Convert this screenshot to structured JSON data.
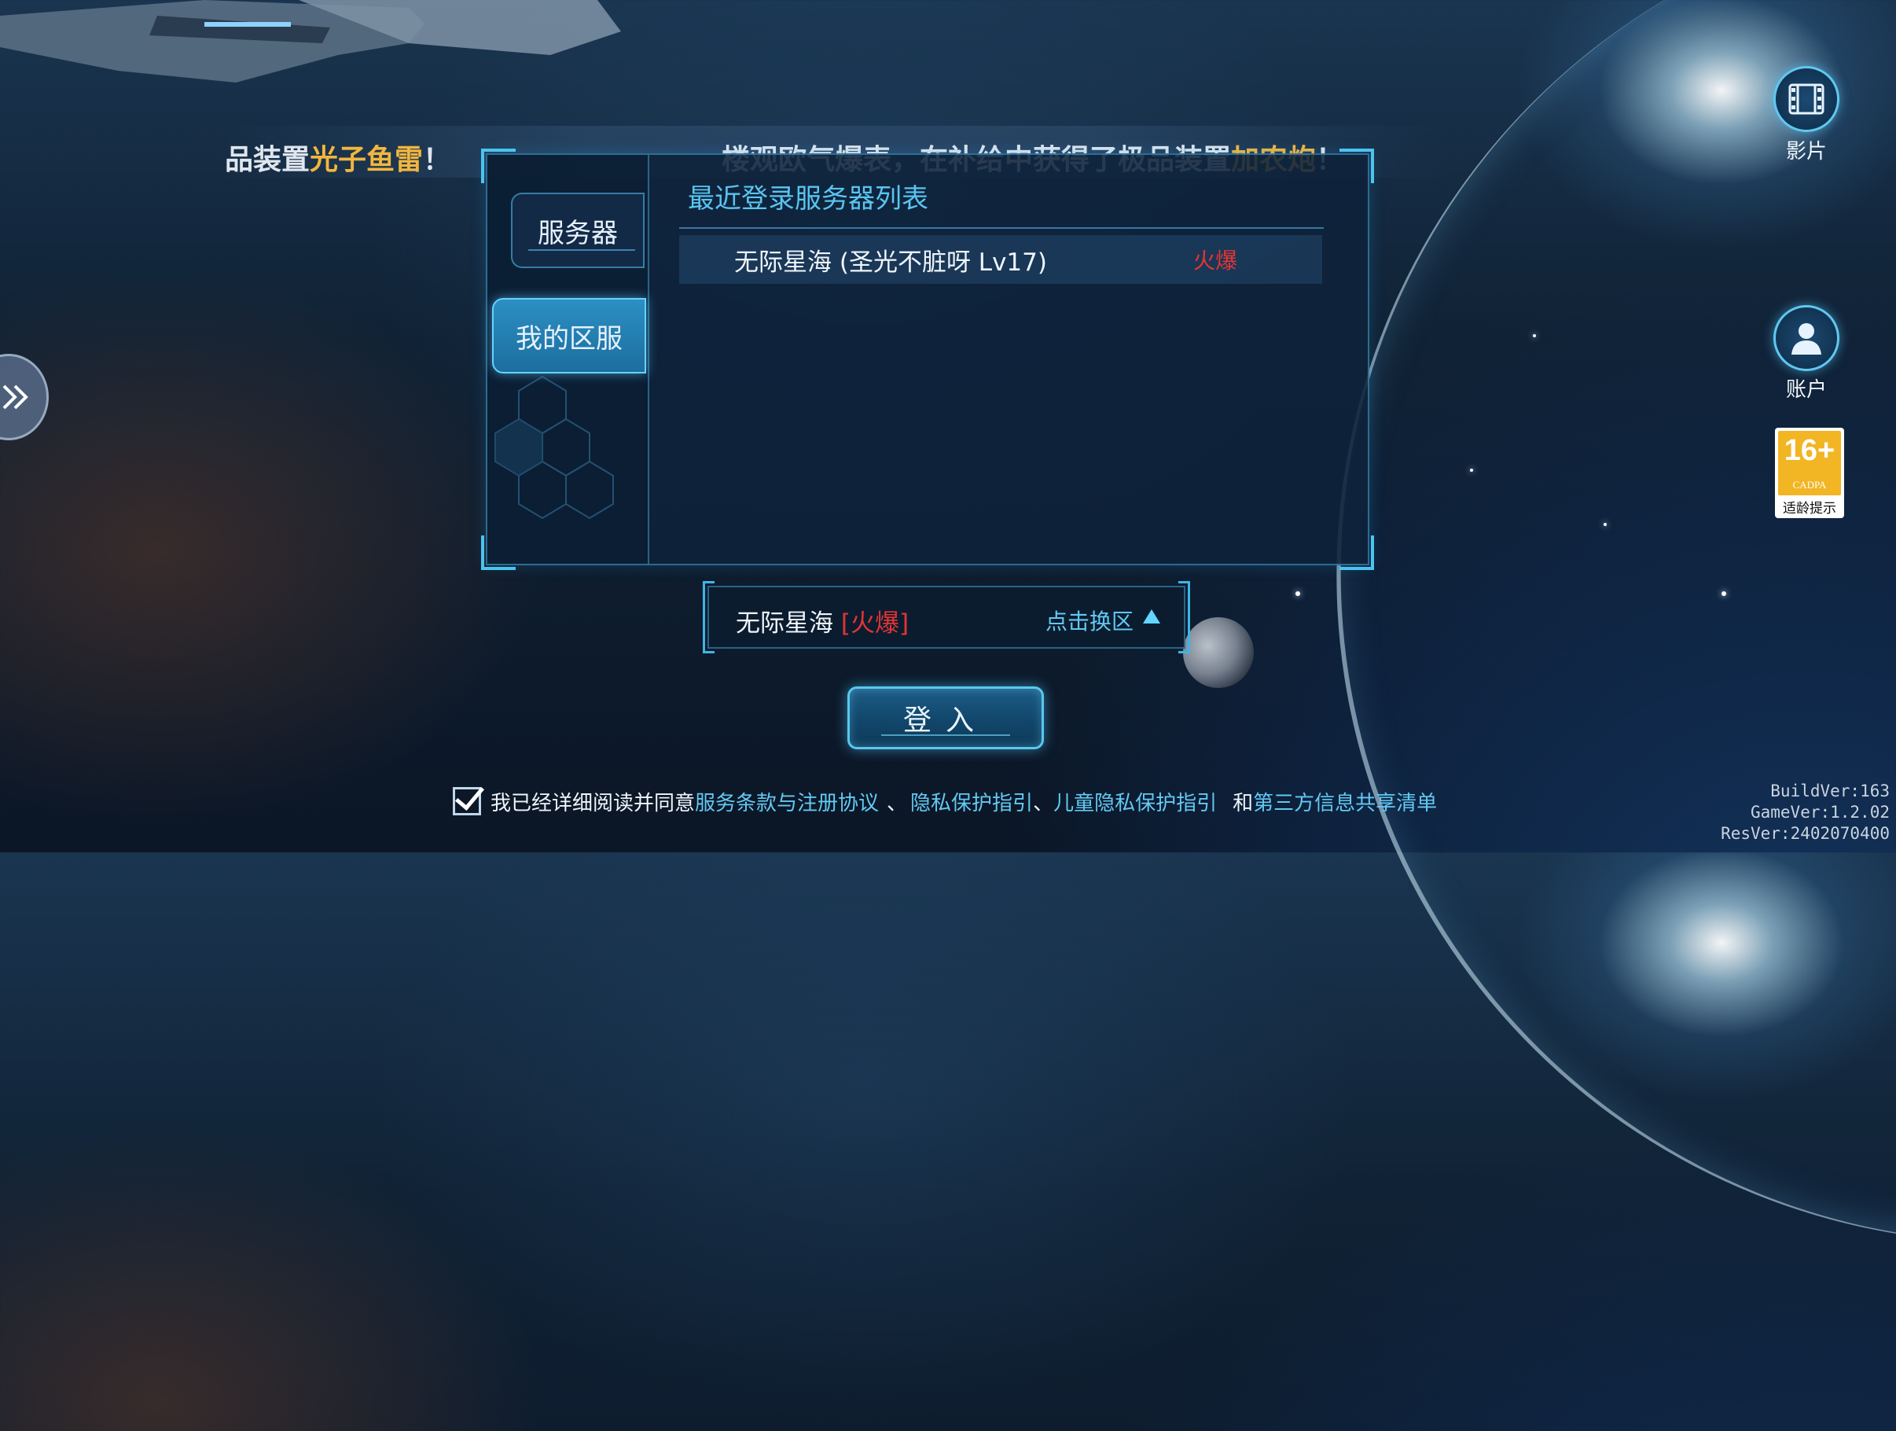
{
  "marquee": {
    "left_prefix": "品装置",
    "left_item": "光子鱼雷",
    "left_suffix": "！",
    "main_prefix": "楼观欧气爆表，在补给中获得了极品装置",
    "main_item": "加农炮",
    "main_suffix": "！"
  },
  "server_panel": {
    "tabs": [
      {
        "label": "服务器",
        "active": false
      },
      {
        "label": "我的区服",
        "active": true
      }
    ],
    "list_title": "最近登录服务器列表",
    "recent_servers": [
      {
        "name": "无际星海 (圣光不脏呀 Lv17)",
        "status": "火爆"
      }
    ]
  },
  "selector": {
    "server_name": "无际星海",
    "server_status": "[火爆]",
    "switch_label": "点击换区"
  },
  "login_button": {
    "label": "登入"
  },
  "agreement": {
    "checked": true,
    "prefix": "我已经详细阅读并同意",
    "terms_link": "服务条款与注册协议",
    "sep1": "、",
    "privacy_link": "隐私保护指引",
    "sep2": "、",
    "child_privacy_link": "儿童隐私保护指引",
    "and": "和",
    "third_party_link": "第三方信息共享清单"
  },
  "side_buttons": {
    "video_label": "影片",
    "account_label": "账户"
  },
  "age_badge": {
    "rating": "16+",
    "org": "CADPA",
    "tip": "适龄提示",
    "color": "#f2b524"
  },
  "versions": {
    "build": "BuildVer:163",
    "game": "GameVer:1.2.02",
    "res": "ResVer:2402070400"
  },
  "colors": {
    "accent": "#59c5f0",
    "hot": "#e23535",
    "highlight": "#f2b63e"
  }
}
